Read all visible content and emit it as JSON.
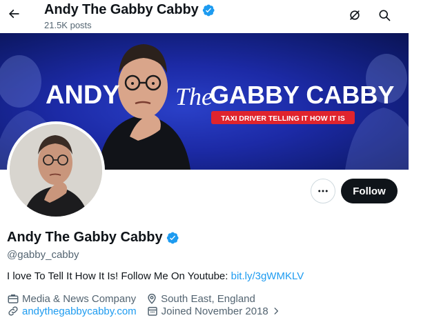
{
  "header": {
    "title": "Andy The Gabby Cabby",
    "post_count": "21.5K posts",
    "back_icon": "arrow-left-icon",
    "grok_icon": "grok-icon",
    "search_icon": "search-icon"
  },
  "banner": {
    "word_andy": "ANDY",
    "word_the": "The",
    "word_cabby": "GABBY CABBY",
    "tagline": "TAXI DRIVER TELLING IT HOW IT IS"
  },
  "profile": {
    "name": "Andy The Gabby Cabby",
    "verified": true,
    "handle": "@gabby_cabby",
    "bio_text": "I love To Tell It How It Is! Follow Me On Youtube: ",
    "bio_link": "bit.ly/3gWMKLV",
    "category": "Media & News Company",
    "location": "South East, England",
    "website": "andythegabbycabby.com",
    "joined": "Joined November 2018"
  },
  "actions": {
    "follow_label": "Follow",
    "more_icon": "more-dots-icon"
  },
  "colors": {
    "accent": "#1d9bf0",
    "text_primary": "#0f1419",
    "text_secondary": "#536471",
    "banner_blue": "#1c2aa6",
    "tagline_red": "#e0242d"
  }
}
